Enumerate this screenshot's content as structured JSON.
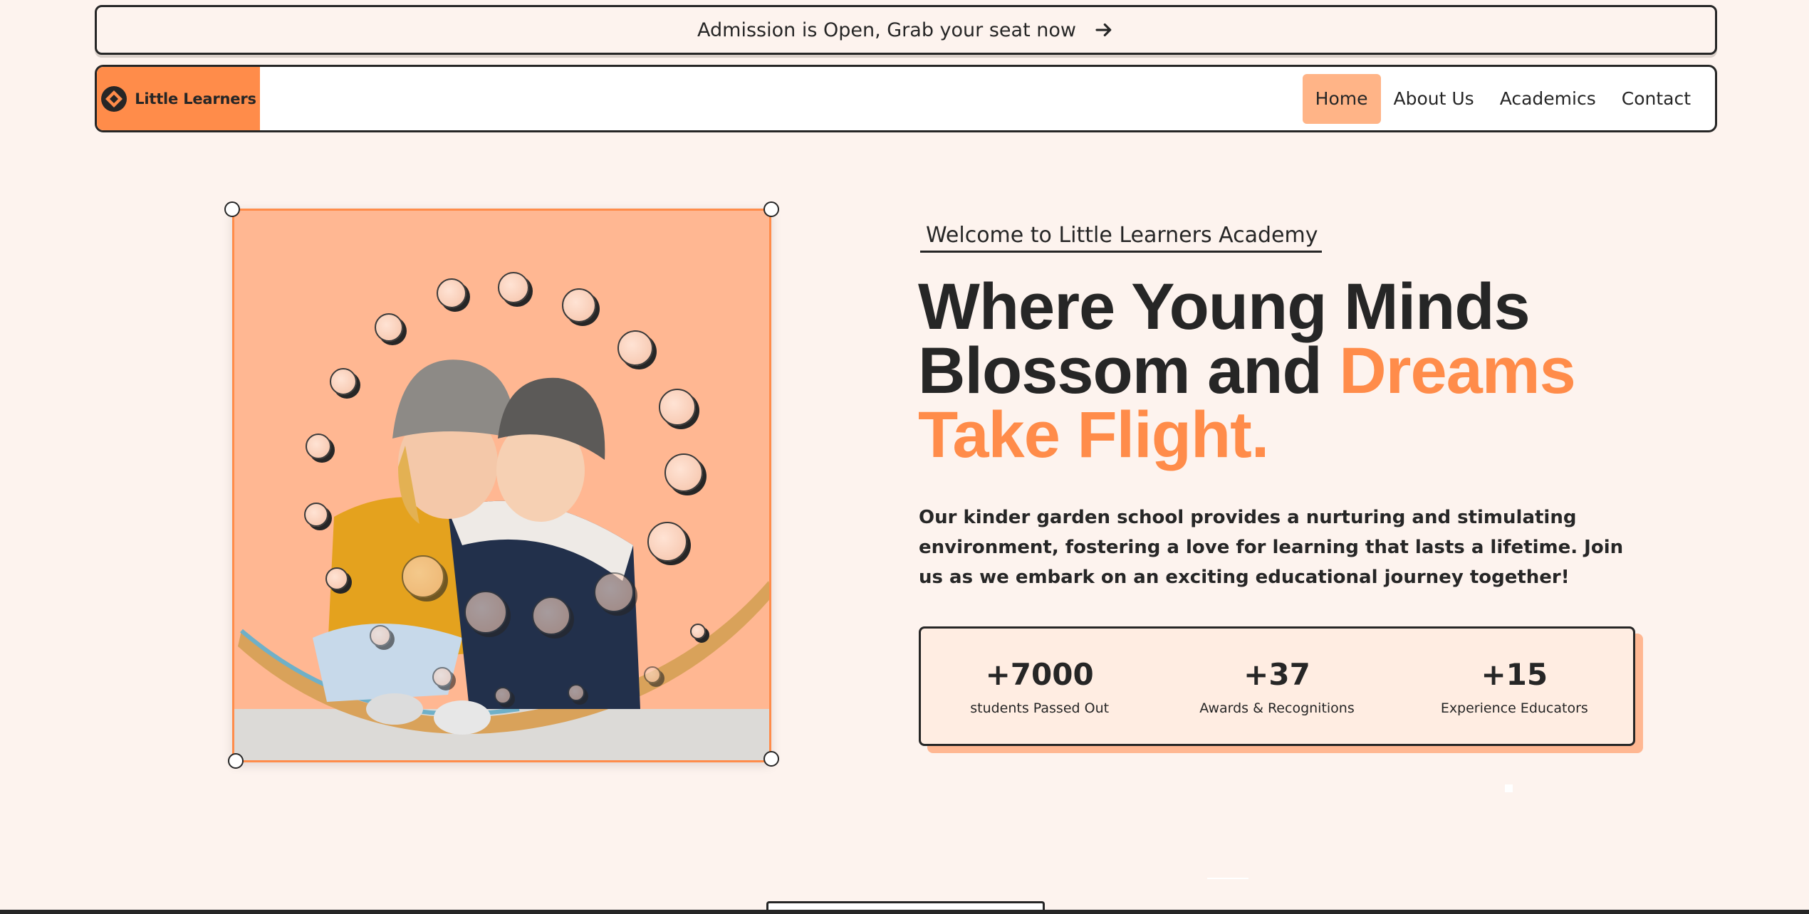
{
  "announcement": {
    "text": "Admission is Open, Grab your seat now",
    "icon": "arrow-right-icon"
  },
  "navbar": {
    "logo_text": "Little Learners",
    "logo_icon": "diamond-logo-icon",
    "links": [
      {
        "label": "Home",
        "active": true
      },
      {
        "label": "About Us",
        "active": false
      },
      {
        "label": "Academics",
        "active": false
      },
      {
        "label": "Contact",
        "active": false
      }
    ]
  },
  "hero": {
    "welcome": "Welcome to Little Learners Academy",
    "headline_line1": "Where Young Minds",
    "headline_line2_plain": "Blossom and",
    "headline_line2_accent": "Dreams",
    "headline_line3_accent": "Take Flight.",
    "description": "Our kinder garden school provides a nurturing and stimulating environment, fostering a love for learning that lasts a lifetime. Join us as we embark on an exciting educational journey together!"
  },
  "stats": [
    {
      "value": "+7000",
      "label": "students Passed Out"
    },
    {
      "value": "+37",
      "label": "Awards & Recognitions"
    },
    {
      "value": "+15",
      "label": "Experience Educators"
    }
  ],
  "colors": {
    "accent": "#ff8c4a",
    "accent_light": "#ffb792",
    "background": "#fdf3ee",
    "dark": "#262626"
  }
}
